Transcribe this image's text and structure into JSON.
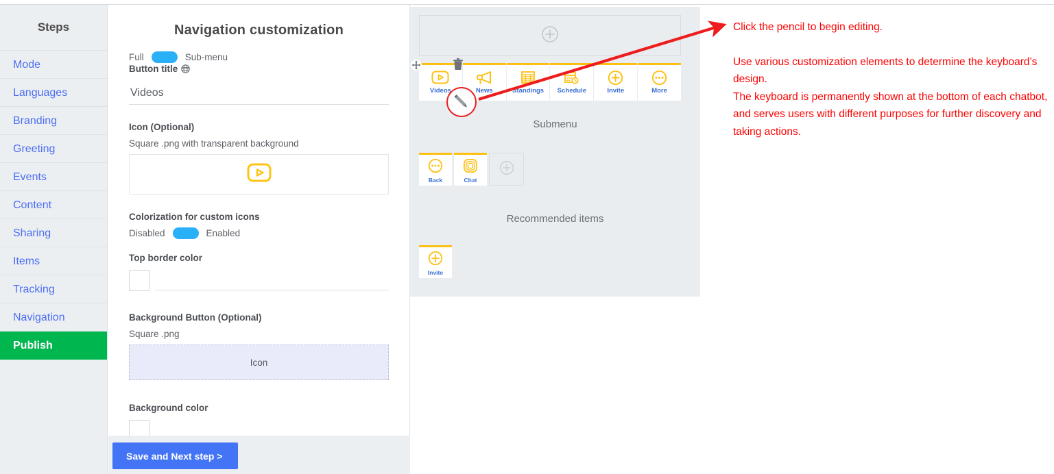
{
  "sidebar": {
    "title": "Steps",
    "items": [
      {
        "label": "Mode",
        "active": false
      },
      {
        "label": "Languages",
        "active": false
      },
      {
        "label": "Branding",
        "active": false
      },
      {
        "label": "Greeting",
        "active": false
      },
      {
        "label": "Events",
        "active": false
      },
      {
        "label": "Content",
        "active": false
      },
      {
        "label": "Sharing",
        "active": false
      },
      {
        "label": "Items",
        "active": false
      },
      {
        "label": "Tracking",
        "active": false
      },
      {
        "label": "Navigation",
        "active": false
      },
      {
        "label": "Publish",
        "active": true
      }
    ]
  },
  "form": {
    "title": "Navigation customization",
    "mode_toggle": {
      "left_label": "Full",
      "right_label": "Sub-menu",
      "state": "left"
    },
    "button_title_label": "Button title",
    "button_title_icon": "globe-icon",
    "button_title_value": "Videos",
    "icon_section_label": "Icon (Optional)",
    "icon_section_hint": "Square .png with transparent background",
    "icon_preview": "play-button-icon",
    "colorization_label": "Colorization for custom icons",
    "colorization_toggle": {
      "left_label": "Disabled",
      "right_label": "Enabled",
      "state": "left"
    },
    "top_border_color_label": "Top border color",
    "top_border_color_value": "#ffffff",
    "background_button_label": "Background Button (Optional)",
    "background_button_hint": "Square .png",
    "background_button_dropzone": "Icon",
    "background_color_label": "Background color",
    "background_color_value": "#ffffff",
    "save_label": "Save and Next step >"
  },
  "preview": {
    "add_row_icon": "plus-circle-icon",
    "main_buttons": [
      {
        "label": "Videos",
        "icon": "play-button-icon"
      },
      {
        "label": "News",
        "icon": "megaphone-icon"
      },
      {
        "label": "Standings",
        "icon": "table-icon"
      },
      {
        "label": "Schedule",
        "icon": "calendar-clock-icon"
      },
      {
        "label": "Invite",
        "icon": "plus-circle-icon"
      },
      {
        "label": "More",
        "icon": "ellipsis-circle-icon"
      }
    ],
    "edit_handles": {
      "move": "move-arrows-icon",
      "delete": "trash-icon",
      "edit": "pencil-icon"
    },
    "submenu_title": "Submenu",
    "submenu_buttons": [
      {
        "label": "Back",
        "icon": "ellipsis-circle-icon"
      },
      {
        "label": "Chat",
        "icon": "chat-square-icon"
      }
    ],
    "submenu_add_icon": "plus-circle-icon",
    "recommended_title": "Recommended items",
    "recommended_buttons": [
      {
        "label": "Invite",
        "icon": "plus-circle-icon"
      }
    ]
  },
  "annotation": {
    "line1": "Click the pencil to begin editing.",
    "line2": "Use various customization elements to determine the keyboard’s design.",
    "line3": "The keyboard is permanently shown at the bottom of each chatbot, and serves users with different purposes for further discovery and taking actions.",
    "color": "#fe0000",
    "arrow": "red-arrow-pointing-upper-right"
  },
  "colors": {
    "accent_yellow": "#fdc012",
    "link_blue": "#3b6fd4",
    "sidebar_link": "#4c6ef5",
    "publish_green": "#00b64f",
    "save_blue": "#4474f6",
    "toggle_blue": "#29b0f7"
  }
}
